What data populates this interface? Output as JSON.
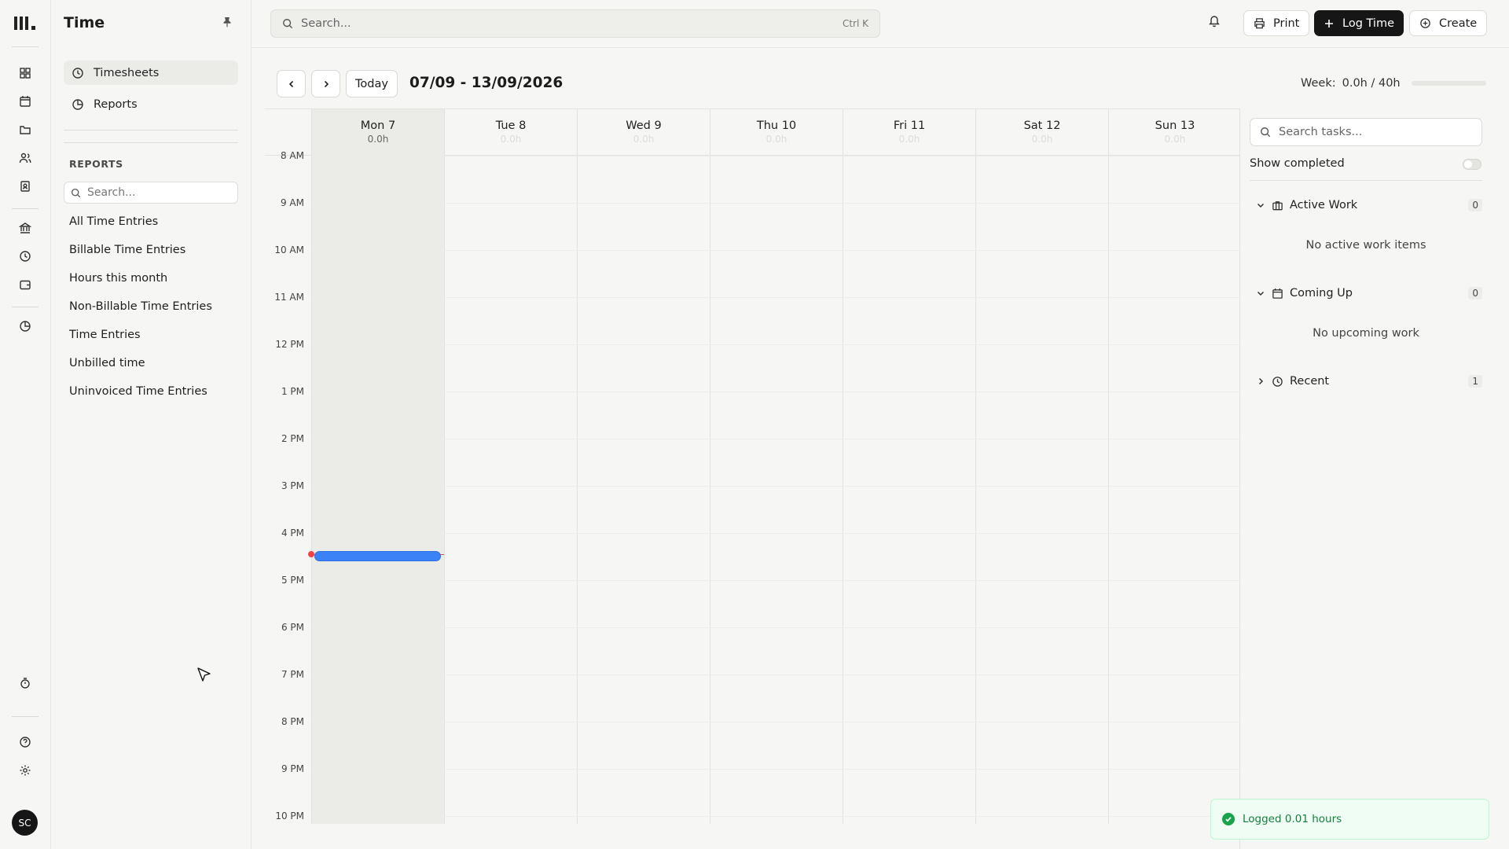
{
  "app": {
    "logo_text": "lll.",
    "module_title": "Time"
  },
  "rail": {
    "icons": [
      "dashboard-icon",
      "calendar-icon",
      "folder-icon",
      "people-icon",
      "contacts-icon",
      "bank-icon",
      "clock-icon",
      "wallet-icon",
      "reports-pie-icon",
      "timer-icon",
      "help-icon",
      "settings-icon"
    ],
    "avatar_initials": "SC"
  },
  "sidebar": {
    "nav": [
      {
        "label": "Timesheets",
        "icon": "clock-icon",
        "active": true
      },
      {
        "label": "Reports",
        "icon": "pie-chart-icon",
        "active": false
      }
    ],
    "section_label": "REPORTS",
    "search_placeholder": "Search...",
    "reports": [
      "All Time Entries",
      "Billable Time Entries",
      "Hours this month",
      "Non-Billable Time Entries",
      "Time Entries",
      "Unbilled time",
      "Uninvoiced Time Entries"
    ]
  },
  "topbar": {
    "search_placeholder": "Search...",
    "shortcut": "Ctrl K",
    "print_label": "Print",
    "log_time_label": "Log Time",
    "create_label": "Create"
  },
  "calendar": {
    "today_label": "Today",
    "range": "07/09 - 13/09/2026",
    "week_label": "Week:",
    "week_value": "0.0h / 40h",
    "week_progress": 0.0,
    "days": [
      {
        "name": "Mon 7",
        "hours": "0.0h",
        "today": true
      },
      {
        "name": "Tue 8",
        "hours": "0.0h",
        "today": false
      },
      {
        "name": "Wed 9",
        "hours": "0.0h",
        "today": false
      },
      {
        "name": "Thu 10",
        "hours": "0.0h",
        "today": false
      },
      {
        "name": "Fri 11",
        "hours": "0.0h",
        "today": false
      },
      {
        "name": "Sat 12",
        "hours": "0.0h",
        "today": false
      },
      {
        "name": "Sun 13",
        "hours": "0.0h",
        "today": false
      }
    ],
    "times": [
      "8 AM",
      "9 AM",
      "10 AM",
      "11 AM",
      "12 PM",
      "1 PM",
      "2 PM",
      "3 PM",
      "4 PM",
      "5 PM",
      "6 PM",
      "7 PM",
      "8 PM",
      "9 PM",
      "10 PM"
    ],
    "now_time": "4:27 PM",
    "now_hour": 16.45
  },
  "tasks": {
    "search_placeholder": "Search tasks...",
    "show_completed_label": "Show completed",
    "show_completed": false,
    "groups": [
      {
        "label": "Active Work",
        "icon": "briefcase-icon",
        "count": "0",
        "expanded": true,
        "empty": "No active work items"
      },
      {
        "label": "Coming Up",
        "icon": "calendar-icon",
        "count": "0",
        "expanded": true,
        "empty": "No upcoming work"
      },
      {
        "label": "Recent",
        "icon": "clock-icon",
        "count": "1",
        "expanded": false,
        "empty": ""
      }
    ]
  },
  "toast": {
    "message": "Logged 0.01 hours",
    "color": "#16a34a"
  }
}
